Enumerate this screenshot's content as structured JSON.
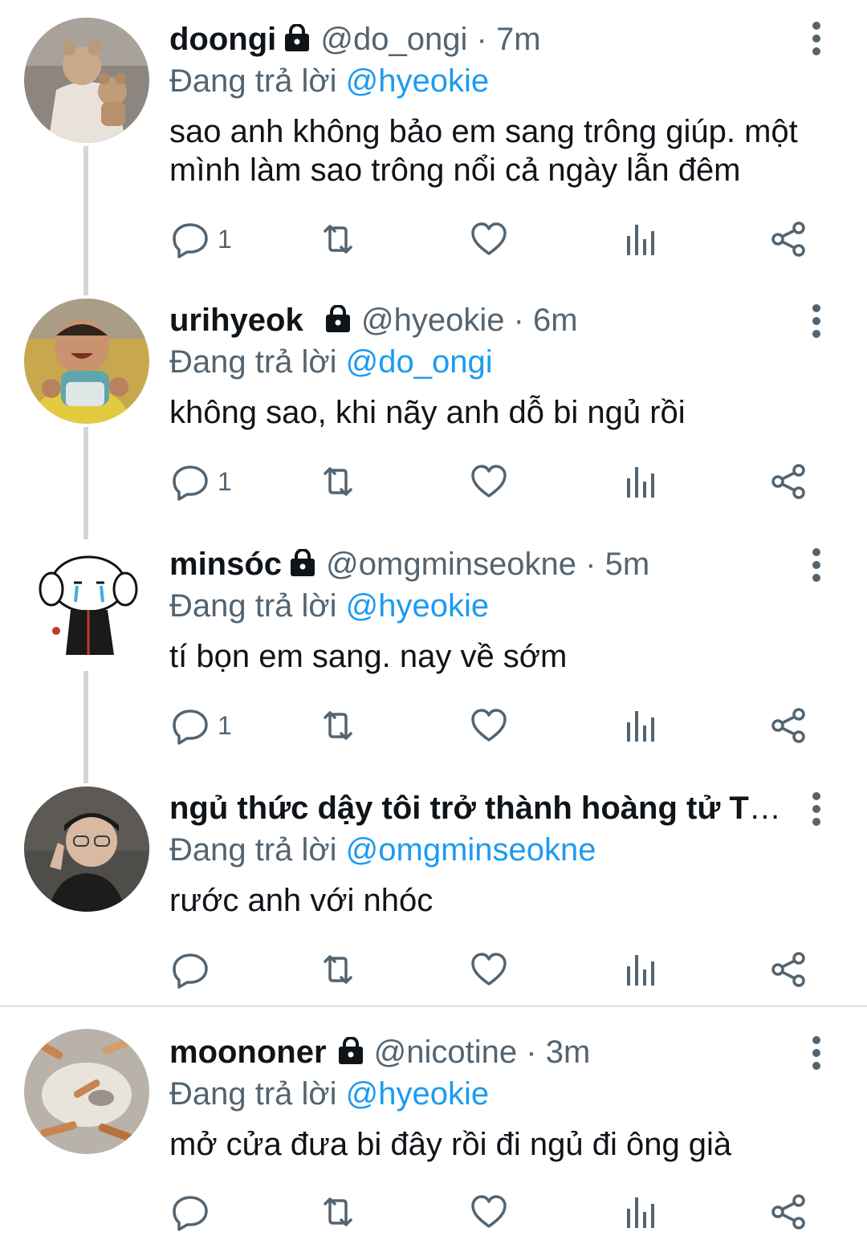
{
  "colors": {
    "accent": "#1d9bf0",
    "secondary": "#536471",
    "text": "#0f1419",
    "thread_line": "#d0d6db"
  },
  "tweets": [
    {
      "name": "doongi",
      "handle": "@do_ongi",
      "time": "7m",
      "replying_prefix": "Đang trả lời",
      "replying_to": "@hyeokie",
      "text": "sao anh không bảo em sang trông giúp. một mình làm sao trông nổi cả ngày lẫn đêm",
      "reply_count": "1",
      "icons": [
        "lock-icon",
        "more-icon",
        "reply-icon",
        "retweet-icon",
        "like-icon",
        "views-icon",
        "share-icon"
      ]
    },
    {
      "name": "urihyeok",
      "handle": "@hyeokie",
      "time": "6m",
      "replying_prefix": "Đang trả lời",
      "replying_to": "@do_ongi",
      "text": "không sao, khi nãy anh dỗ bi ngủ rồi",
      "reply_count": "1"
    },
    {
      "name": "minsóc",
      "handle": "@omgminseokne",
      "time": "5m",
      "replying_prefix": "Đang trả lời",
      "replying_to": "@hyeokie",
      "text": "tí bọn em sang. nay về sớm",
      "reply_count": "1"
    },
    {
      "name": "ngủ thức dậy tôi trở thành hoàng tử T1...",
      "replying_prefix": "Đang trả lời",
      "replying_to": "@omgminseokne",
      "text": "rước anh với nhóc",
      "reply_count": ""
    },
    {
      "name": "moononer",
      "handle": "@nicotine",
      "time": "3m",
      "replying_prefix": "Đang trả lời",
      "replying_to": "@hyeokie",
      "text": "mở cửa đưa bi đây rồi đi ngủ đi ông già",
      "reply_count": ""
    }
  ],
  "separator": "·"
}
